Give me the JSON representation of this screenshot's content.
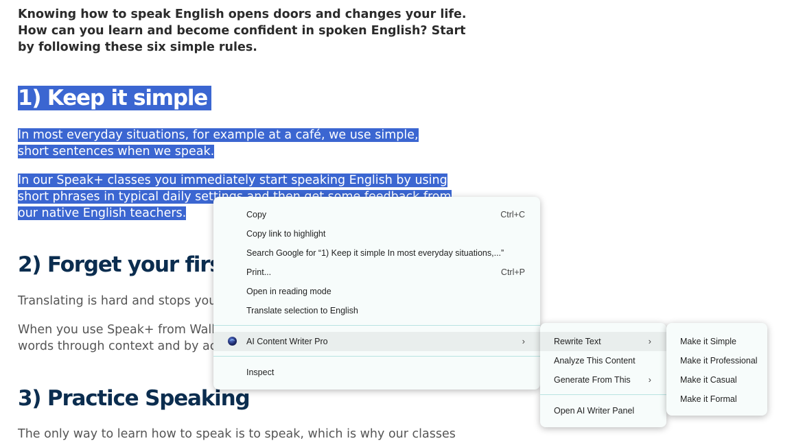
{
  "article": {
    "intro": "Knowing how to speak English opens doors and changes your life. How can you learn and become confident in spoken English? Start by following these six simple rules.",
    "heading1": "1) Keep it simple",
    "p1": "In most everyday situations, for example at a café, we use simple, short sentences when we speak.",
    "p2": "In our Speak+ classes you immediately start speaking English by using short phrases in typical daily settings and then get some feedback from our native English teachers.",
    "heading2": "2) Forget your first",
    "p3": "Translating is hard and stops you f",
    "p4_line1": "When you use Speak+ from Wall S",
    "p4_line2": "words through context and by act",
    "heading3": "3) Practice Speaking",
    "p5": "The only way to learn how to speak is to speak, which is why our classes"
  },
  "context_menu": {
    "copy": "Copy",
    "copy_shortcut": "Ctrl+C",
    "copy_link": "Copy link to highlight",
    "search_google": "Search Google for “1) Keep it simple In most everyday situations,...”",
    "print": "Print...",
    "print_shortcut": "Ctrl+P",
    "reading_mode": "Open in reading mode",
    "translate": "Translate selection to English",
    "ai_writer": "AI Content Writer Pro",
    "inspect": "Inspect"
  },
  "ai_submenu": {
    "rewrite": "Rewrite Text",
    "analyze": "Analyze This Content",
    "generate": "Generate From This",
    "open_panel": "Open AI Writer Panel"
  },
  "rewrite_submenu": {
    "simple": "Make it Simple",
    "professional": "Make it Professional",
    "casual": "Make it Casual",
    "formal": "Make it Formal"
  },
  "icons": {
    "submenu_arrow": "chevron-right-icon",
    "ai_writer": "ai-writer-logo-icon"
  },
  "colors": {
    "selection": "#3b66d1",
    "heading": "#0b2d4f",
    "menu_bg": "#f7fcfb",
    "menu_separator": "#b8e3e1"
  }
}
